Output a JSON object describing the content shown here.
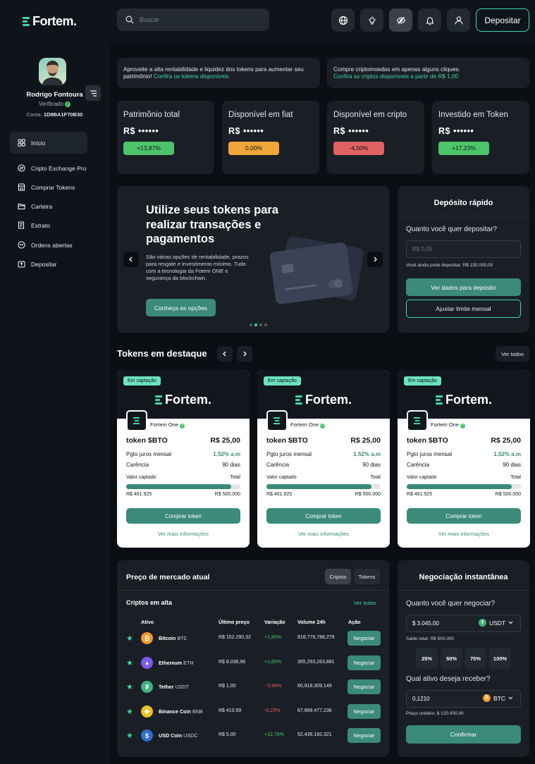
{
  "brand": {
    "name": "Fortem."
  },
  "search": {
    "placeholder": "Buscar"
  },
  "header": {
    "deposit_label": "Depositar"
  },
  "user": {
    "name": "Rodrigo Fontoura",
    "status": "Verificado",
    "account_label": "Conta:",
    "account_id": "1D8BA1F70B30"
  },
  "nav": [
    {
      "label": "Início",
      "icon": "grid-icon"
    },
    {
      "label": "Cripto Exchange Pro",
      "icon": "exchange-icon"
    },
    {
      "label": "Comprar Tokens",
      "icon": "store-icon"
    },
    {
      "label": "Carteira",
      "icon": "folder-icon"
    },
    {
      "label": "Extrato",
      "icon": "statement-icon"
    },
    {
      "label": "Ordens abertas",
      "icon": "orders-icon"
    },
    {
      "label": "Depositar",
      "icon": "deposit-icon"
    }
  ],
  "promos": [
    {
      "text": "Aproveite a alta rentabilidade e liquidez dos tokens  para aumentar seu patrimônio!",
      "link": "Confira os tokens disponíveis"
    },
    {
      "text": "Compre criptomoedas em apenas alguns cliques.",
      "link": "Confira as criptos disponíveis a partir de R$ 1,00"
    }
  ],
  "stats": [
    {
      "title": "Patrimônio total",
      "value": "R$ ••••••",
      "change": "+13,87%",
      "color": "#4cc46a"
    },
    {
      "title": "Disponível em fiat",
      "value": "R$ ••••••",
      "change": "0,00%",
      "color": "#f0a63a"
    },
    {
      "title": "Disponível em cripto",
      "value": "R$ ••••••",
      "change": "-4,50%",
      "color": "#e06262"
    },
    {
      "title": "Investido em Token",
      "value": "R$ ••••••",
      "change": "+17,23%",
      "color": "#4cc46a"
    }
  ],
  "hero": {
    "title": "Utilize seus tokens para realizar transações e pagamentos",
    "description": "São várias opções de rentabilidade, prazos para resgate e investimento mínimo. Tudo com a tecnologia da Fotem ONE e segurança da blockchain.",
    "button": "Conheça as opções",
    "slide_count": 4,
    "active_slide": 1
  },
  "quick_deposit": {
    "title": "Depósito rápido",
    "question": "Quanto você quer depositar?",
    "placeholder": "R$ 0,00",
    "note": "Você ainda pode depositar: R$ 150.000,00",
    "primary": "Ver dados para depósito",
    "secondary": "Ajustar limite mensal"
  },
  "featured": {
    "title": "Tokens em destaque",
    "see_all": "Ver todos",
    "cards": [
      {
        "badge": "Em captação",
        "brand": "Fortem.",
        "issuer": "Fortem One",
        "token": "token $BTO",
        "price": "R$ 25,00",
        "rate_label": "Pgto juros mensal",
        "rate": "1.52% a.m",
        "grace_label": "Carência",
        "grace": "90 dias",
        "raised_label": "Valor captado",
        "total_label": "Total",
        "raised": "R$ 461.925",
        "total": "R$ 500.000",
        "progress": 0.92,
        "buy": "Comprar token",
        "more": "Ver mais informações"
      },
      {
        "badge": "Em captação",
        "brand": "Fortem.",
        "issuer": "Fortem One",
        "token": "token $BTO",
        "price": "R$ 25,00",
        "rate_label": "Pgto juros mensal",
        "rate": "1.52% a.m",
        "grace_label": "Carência",
        "grace": "90 dias",
        "raised_label": "Valor captado",
        "total_label": "Total",
        "raised": "R$ 461.925",
        "total": "R$ 500.000",
        "progress": 0.92,
        "buy": "Comprar token",
        "more": "Ver mais informações"
      },
      {
        "badge": "Em captação",
        "brand": "Fortem.",
        "issuer": "Fortem One",
        "token": "token $BTO",
        "price": "R$ 25,00",
        "rate_label": "Pgto juros mensal",
        "rate": "1.52% a.m",
        "grace_label": "Carência",
        "grace": "90 dias",
        "raised_label": "Valor captado",
        "total_label": "Total",
        "raised": "R$ 461.925",
        "total": "R$ 500.000",
        "progress": 0.92,
        "buy": "Comprar token",
        "more": "Ver mais informações"
      }
    ]
  },
  "market": {
    "title": "Preço de mercado atual",
    "tabs": [
      "Criptos",
      "Tokens"
    ],
    "subtitle": "Criptos em alta",
    "see_all": "Ver todas",
    "columns": [
      "Ativo",
      "Último preço",
      "Variação",
      "Volume 24h",
      "Ação"
    ],
    "rows": [
      {
        "name": "Bitcoin",
        "symbol": "BTC",
        "price": "R$ 102.290,32",
        "change": "+1,90%",
        "positive": true,
        "volume": "818,779,788,279",
        "action": "Negociar",
        "color": "#f29a2e",
        "glyph": "₿"
      },
      {
        "name": "Ethereum",
        "symbol": "ETH",
        "price": "R$ 8.036,96",
        "change": "+1,60%",
        "positive": true,
        "volume": "365,293,263,881",
        "action": "Negociar",
        "color": "#7b5cf0",
        "glyph": "♦"
      },
      {
        "name": "Tether",
        "symbol": "USDT",
        "price": "R$ 1,00",
        "change": "- 0,54%",
        "positive": false,
        "volume": "80,918,309,149",
        "action": "Negociar",
        "color": "#3fb27f",
        "glyph": "₮"
      },
      {
        "name": "Binance Coin",
        "symbol": "BNB",
        "price": "R$ 410,69",
        "change": "-0,23%",
        "positive": false,
        "volume": "67,889,477,236",
        "action": "Negociar",
        "color": "#f0c020",
        "glyph": "◆"
      },
      {
        "name": "USD Coin",
        "symbol": "USDC",
        "price": "R$ 5,00",
        "change": "+12,78%",
        "positive": true,
        "volume": "52,439,192,321",
        "action": "Negociar",
        "color": "#2f6fd1",
        "glyph": "$"
      }
    ]
  },
  "instant": {
    "title": "Negociação instantânea",
    "q1": "Quanto você quer negociar?",
    "amount": "$ 3.045,00",
    "amount_currency": "USDT",
    "balance": "Saldo total: R$ 500.000",
    "percents": [
      "25%",
      "50%",
      "75%",
      "100%"
    ],
    "q2": "Qual ativo deseja receber?",
    "receive": "0,1210",
    "receive_currency": "BTC",
    "unit_price": "Preço unitário: $ 120.000,00",
    "confirm": "Confirmar"
  },
  "colors": {
    "accent": "#3fd6a6",
    "button": "#3b8a7a",
    "positive": "#4cc46a",
    "negative": "#e06262"
  }
}
